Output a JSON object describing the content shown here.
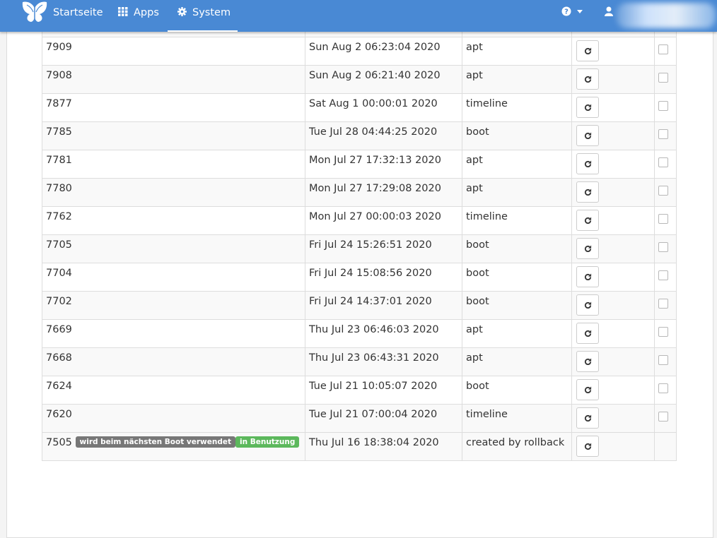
{
  "navbar": {
    "items": [
      {
        "label": "Startseite"
      },
      {
        "label": "Apps"
      },
      {
        "label": "System"
      }
    ]
  },
  "colors": {
    "navbar": "#4989d4",
    "badge_default": "#777777",
    "badge_success": "#5cb85c"
  },
  "table": {
    "rows": [
      {
        "number": "7909",
        "date": "Sun Aug 2 06:23:04 2020",
        "type": "apt"
      },
      {
        "number": "7908",
        "date": "Sun Aug 2 06:21:40 2020",
        "type": "apt"
      },
      {
        "number": "7877",
        "date": "Sat Aug 1 00:00:01 2020",
        "type": "timeline"
      },
      {
        "number": "7785",
        "date": "Tue Jul 28 04:44:25 2020",
        "type": "boot"
      },
      {
        "number": "7781",
        "date": "Mon Jul 27 17:32:13 2020",
        "type": "apt"
      },
      {
        "number": "7780",
        "date": "Mon Jul 27 17:29:08 2020",
        "type": "apt"
      },
      {
        "number": "7762",
        "date": "Mon Jul 27 00:00:03 2020",
        "type": "timeline"
      },
      {
        "number": "7705",
        "date": "Fri Jul 24 15:26:51 2020",
        "type": "boot"
      },
      {
        "number": "7704",
        "date": "Fri Jul 24 15:08:56 2020",
        "type": "boot"
      },
      {
        "number": "7702",
        "date": "Fri Jul 24 14:37:01 2020",
        "type": "boot"
      },
      {
        "number": "7669",
        "date": "Thu Jul 23 06:46:03 2020",
        "type": "apt"
      },
      {
        "number": "7668",
        "date": "Thu Jul 23 06:43:31 2020",
        "type": "apt"
      },
      {
        "number": "7624",
        "date": "Tue Jul 21 10:05:07 2020",
        "type": "boot"
      },
      {
        "number": "7620",
        "date": "Tue Jul 21 07:00:04 2020",
        "type": "timeline"
      }
    ],
    "last_row": {
      "number": "7505",
      "badge_next_boot": "wird beim nächsten Boot verwendet",
      "badge_in_use": "in Benutzung",
      "date": "Thu Jul 16 18:38:04 2020",
      "type": "created by rollback"
    }
  }
}
